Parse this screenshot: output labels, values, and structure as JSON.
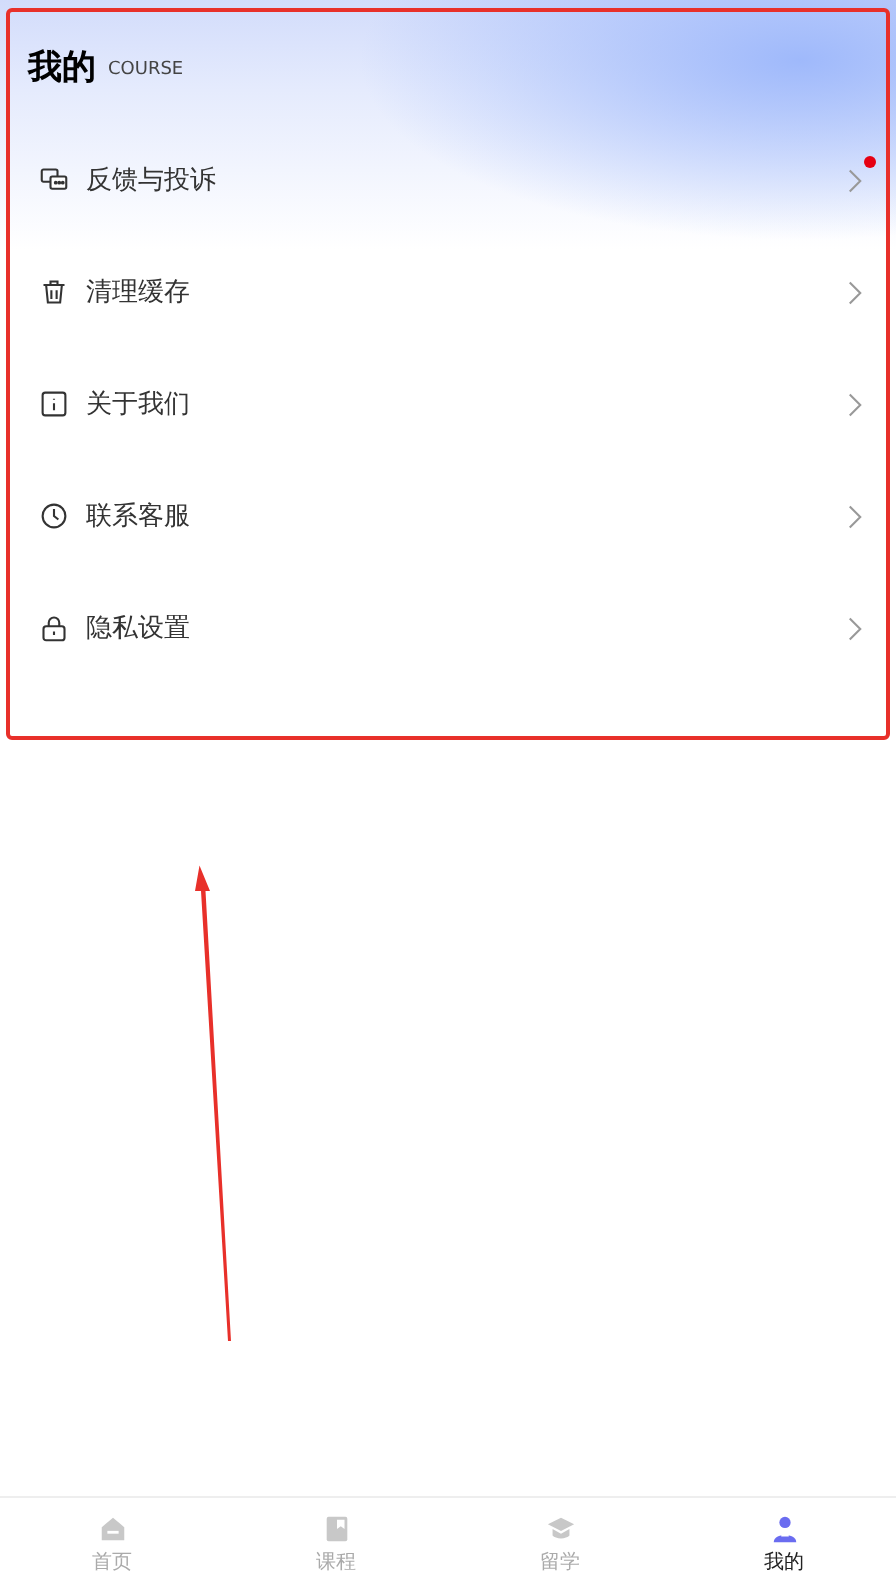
{
  "header": {
    "title": "我的",
    "subtitle": "COURSE"
  },
  "menu": [
    {
      "label": "反馈与投诉",
      "badge": true
    },
    {
      "label": "清理缓存",
      "badge": false
    },
    {
      "label": "关于我们",
      "badge": false
    },
    {
      "label": "联系客服",
      "badge": false
    },
    {
      "label": "隐私设置",
      "badge": false
    }
  ],
  "tab_bar": [
    {
      "label": "首页",
      "selected": false
    },
    {
      "label": "课程",
      "selected": false
    },
    {
      "label": "留学",
      "selected": false
    },
    {
      "label": "我的",
      "selected": true
    }
  ]
}
